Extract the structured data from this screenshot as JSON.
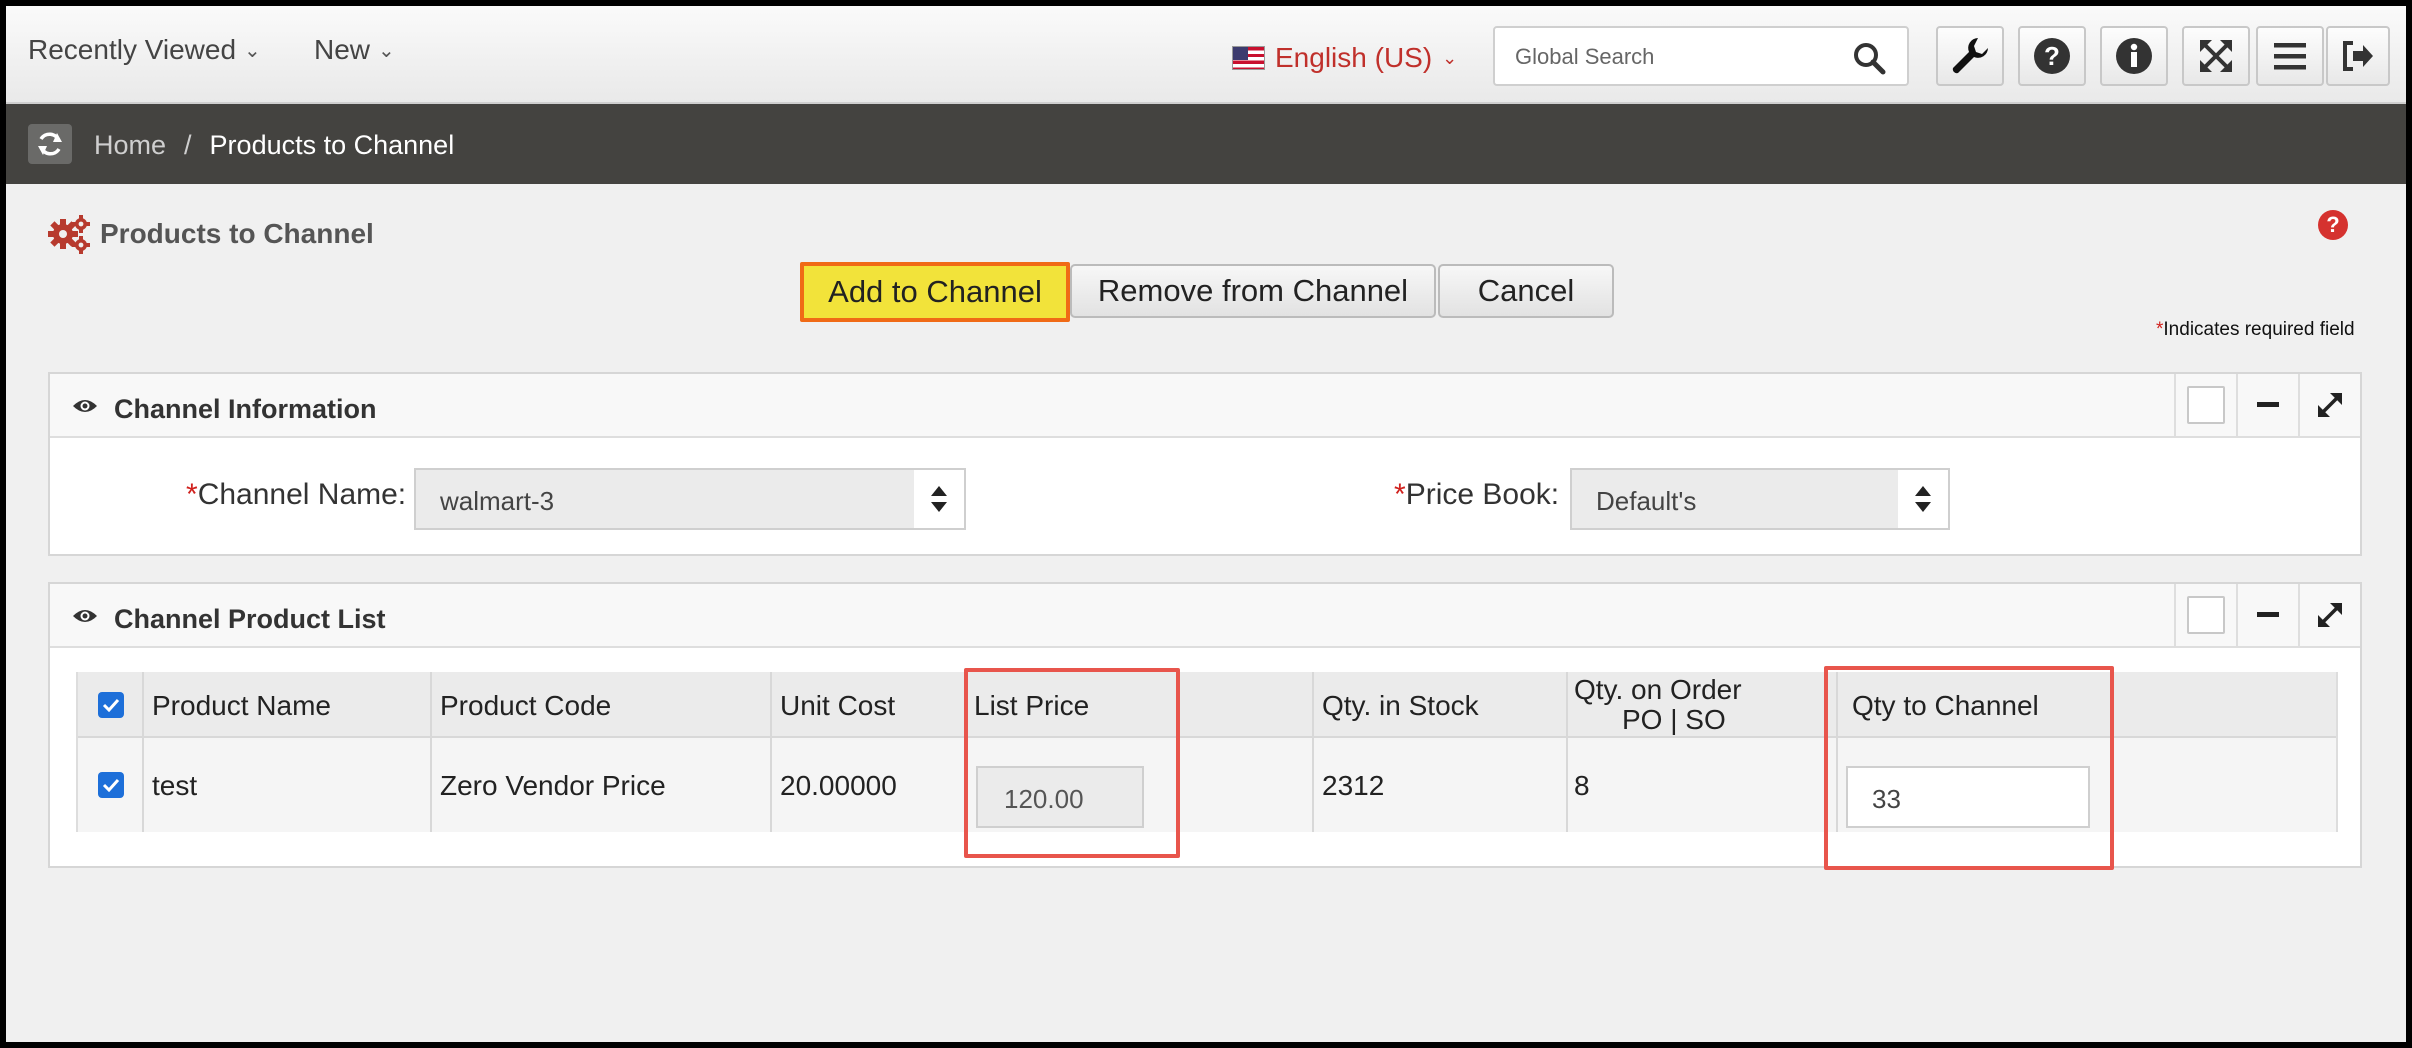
{
  "topbar": {
    "recently_viewed": "Recently Viewed",
    "new": "New",
    "language": "English (US)",
    "search_placeholder": "Global Search"
  },
  "breadcrumb": {
    "home": "Home",
    "separator": "/",
    "current": "Products to Channel"
  },
  "page": {
    "title": "Products to Channel",
    "help": "?",
    "buttons": {
      "add": "Add to Channel",
      "remove": "Remove from Channel",
      "cancel": "Cancel"
    },
    "required_star": "*",
    "required_note": "Indicates required field"
  },
  "channel_info": {
    "title": "Channel Information",
    "channel_name_label": "Channel Name:",
    "channel_name_value": "walmart-3",
    "price_book_label": "Price Book:",
    "price_book_value": "Default's"
  },
  "product_list": {
    "title": "Channel Product List",
    "headers": {
      "product_name": "Product Name",
      "product_code": "Product Code",
      "unit_cost": "Unit Cost",
      "list_price": "List Price",
      "qty_stock": "Qty. in Stock",
      "qty_order_line1": "Qty. on Order",
      "qty_order_line2": "PO | SO",
      "qty_channel": "Qty to Channel"
    },
    "rows": [
      {
        "product_name": "test",
        "product_code": "Zero Vendor Price",
        "unit_cost": "20.00000",
        "list_price": "120.00",
        "qty_stock": "2312",
        "qty_order": "8",
        "qty_channel": "33"
      }
    ]
  },
  "colors": {
    "accent_red": "#c0302b",
    "primary_button": "#f2e33a",
    "primary_border": "#f06a16",
    "highlight": "#e8554c",
    "crumb_bar": "#444340"
  }
}
